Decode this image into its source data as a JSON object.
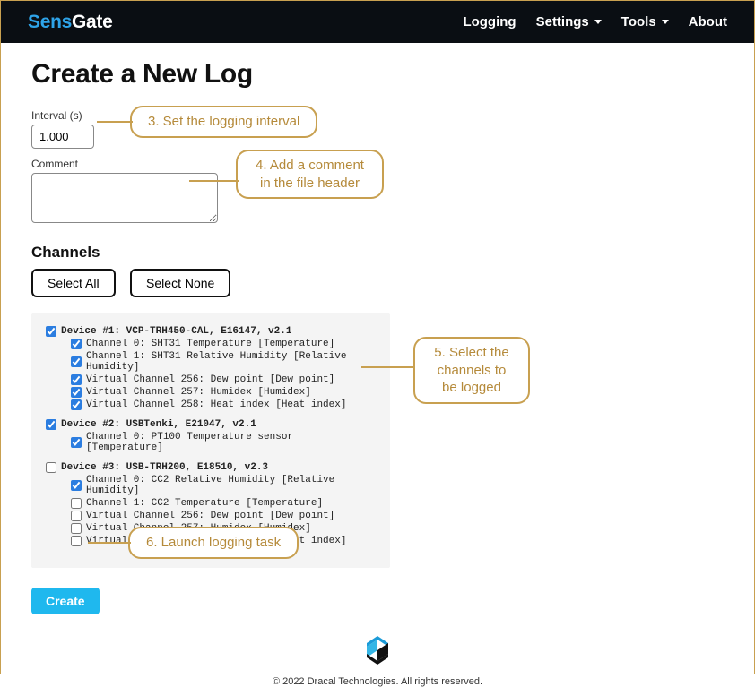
{
  "brand": {
    "part1": "Sens",
    "part2": "Gate"
  },
  "nav": {
    "logging": "Logging",
    "settings": "Settings",
    "tools": "Tools",
    "about": "About"
  },
  "page": {
    "title": "Create a New Log",
    "interval_label": "Interval (s)",
    "interval_value": "1.000",
    "comment_label": "Comment",
    "comment_value": "",
    "channels_heading": "Channels",
    "select_all": "Select All",
    "select_none": "Select None",
    "create": "Create"
  },
  "devices": [
    {
      "label": "Device #1: VCP-TRH450-CAL, E16147, v2.1",
      "checked": true,
      "channels": [
        {
          "label": "Channel 0: SHT31 Temperature [Temperature]",
          "checked": true
        },
        {
          "label": "Channel 1: SHT31 Relative Humidity [Relative Humidity]",
          "checked": true
        },
        {
          "label": "Virtual Channel 256: Dew point [Dew point]",
          "checked": true
        },
        {
          "label": "Virtual Channel 257: Humidex [Humidex]",
          "checked": true
        },
        {
          "label": "Virtual Channel 258: Heat index [Heat index]",
          "checked": true
        }
      ]
    },
    {
      "label": "Device #2: USBTenki, E21047, v2.1",
      "checked": true,
      "channels": [
        {
          "label": "Channel 0: PT100 Temperature sensor [Temperature]",
          "checked": true
        }
      ]
    },
    {
      "label": "Device #3: USB-TRH200, E18510, v2.3",
      "checked": false,
      "channels": [
        {
          "label": "Channel 0: CC2 Relative Humidity [Relative Humidity]",
          "checked": true
        },
        {
          "label": "Channel 1: CC2 Temperature [Temperature]",
          "checked": false
        },
        {
          "label": "Virtual Channel 256: Dew point [Dew point]",
          "checked": false
        },
        {
          "label": "Virtual Channel 257: Humidex [Humidex]",
          "checked": false
        },
        {
          "label": "Virtual Channel 258: Heat index [Heat index]",
          "checked": false
        }
      ]
    }
  ],
  "callouts": {
    "c3": "3. Set the logging interval",
    "c4": "4. Add a comment in the file header",
    "c5": "5. Select the channels to be logged",
    "c6": "6. Launch logging task"
  },
  "footer": "© 2022 Dracal Technologies. All rights reserved."
}
